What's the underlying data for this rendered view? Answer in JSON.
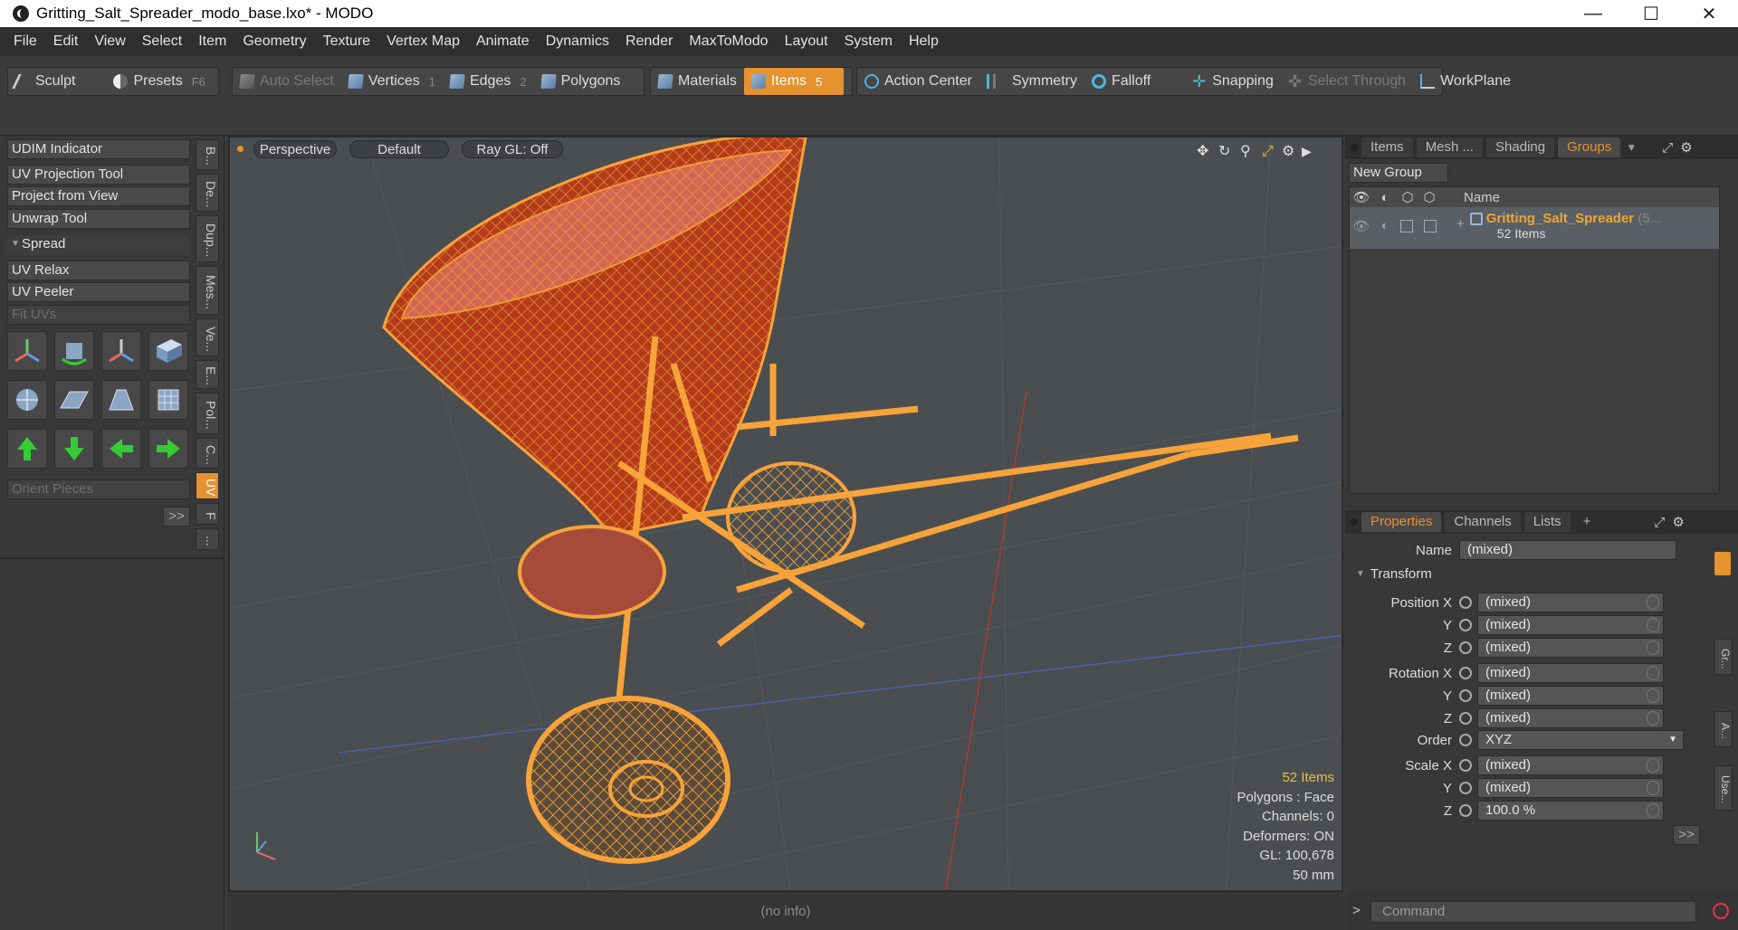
{
  "window": {
    "title": "Gritting_Salt_Spreader_modo_base.lxo* - MODO",
    "minimize": "—",
    "maximize": "☐",
    "close": "✕"
  },
  "menu": [
    "File",
    "Edit",
    "View",
    "Select",
    "Item",
    "Geometry",
    "Texture",
    "Vertex Map",
    "Animate",
    "Dynamics",
    "Render",
    "MaxToModo",
    "Layout",
    "System",
    "Help"
  ],
  "toolbar": {
    "sculpt": "Sculpt",
    "presets": "Presets",
    "presets_key": "F6",
    "auto_select": "Auto Select",
    "vertices": "Vertices",
    "vertices_num": "1",
    "edges": "Edges",
    "edges_num": "2",
    "polygons": "Polygons",
    "materials": "Materials",
    "items": "Items",
    "items_num": "5",
    "action_center": "Action Center",
    "symmetry": "Symmetry",
    "falloff": "Falloff",
    "snapping": "Snapping",
    "select_through": "Select Through",
    "workplane": "WorkPlane"
  },
  "left_panel": {
    "udim_indicator": "UDIM Indicator",
    "uv_projection_tool": "UV Projection Tool",
    "project_from_view": "Project from View",
    "unwrap_tool": "Unwrap Tool",
    "spread": "Spread",
    "uv_relax": "UV Relax",
    "uv_peeler": "UV Peeler",
    "fit_uvs": "Fit UVs",
    "orient_pieces": "Orient Pieces",
    "more": ">>",
    "vtabs": [
      "B...",
      "De...",
      "Dup...",
      "Mes...",
      "Ve...",
      "E...",
      "Pol...",
      "C...",
      "UV",
      "F",
      "..."
    ]
  },
  "viewport": {
    "perspective": "Perspective",
    "default": "Default",
    "raygl": "Ray GL: Off",
    "items_count": "52 Items",
    "polygons": "Polygons : Face",
    "channels": "Channels: 0",
    "deformers": "Deformers: ON",
    "gl": "GL: 100,678",
    "unit": "50 mm",
    "status": "(no info)"
  },
  "right_panel": {
    "tabs": [
      "Items",
      "Mesh ...",
      "Shading",
      "Groups"
    ],
    "new_group": "New Group",
    "col_name": "Name",
    "group_name": "Gritting_Salt_Spreader",
    "group_suffix": "(5...",
    "group_count": "52 Items",
    "prop_tabs": [
      "Properties",
      "Channels",
      "Lists"
    ],
    "add_tab": "+",
    "name_label": "Name",
    "name_value": "(mixed)",
    "transform": "Transform",
    "position_x": "Position X",
    "y": "Y",
    "z": "Z",
    "rotation_x": "Rotation X",
    "order": "Order",
    "order_value": "XYZ",
    "scale_x": "Scale X",
    "mixed": "(mixed)",
    "scale_z_value": "100.0 %",
    "more": ">>",
    "side_tabs": [
      "Gr...",
      "A...",
      "Use..."
    ],
    "command": "Command",
    "cmd_prompt": ">"
  },
  "colors": {
    "accent": "#e6922e",
    "mesh": "#f7a33a"
  }
}
